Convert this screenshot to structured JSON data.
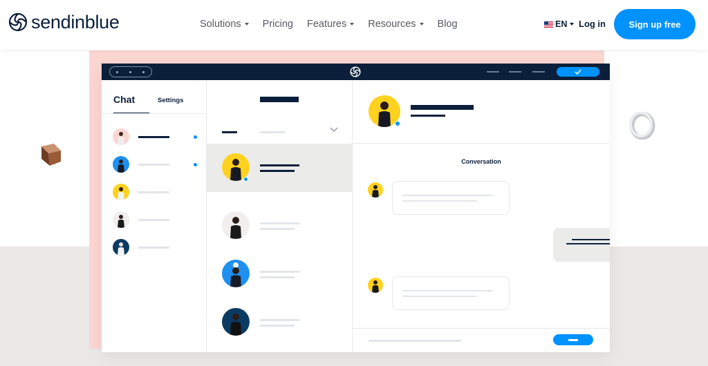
{
  "brand": {
    "name": "sendinblue",
    "color": "#0b1f3a",
    "accent": "#0092ff"
  },
  "nav": {
    "menu": [
      {
        "label": "Solutions",
        "has_dropdown": true
      },
      {
        "label": "Pricing",
        "has_dropdown": false
      },
      {
        "label": "Features",
        "has_dropdown": true
      },
      {
        "label": "Resources",
        "has_dropdown": true
      },
      {
        "label": "Blog",
        "has_dropdown": false
      }
    ],
    "language": "EN",
    "login": "Log in",
    "signup": "Sign up free"
  },
  "chat_app": {
    "tabs": [
      {
        "label": "Chat",
        "active": true
      },
      {
        "label": "Settings",
        "active": false
      }
    ],
    "contact_avatar_colors": [
      "#fbd6d1",
      "#1e90f0",
      "#ffd21f",
      "#f1efee",
      "#0b3a63"
    ],
    "conversation_avatar_colors": [
      "#ffd21f",
      "#f1efee",
      "#1e90f0",
      "#0b3a63"
    ],
    "conversation_label": "Conversation",
    "icons": [
      "sendinblue-logo-icon",
      "checkmark-icon",
      "chevron-down-icon",
      "minus-icon"
    ]
  },
  "colors": {
    "pink_panel": "#fbd6d1",
    "lower_background": "#e9e8e6"
  }
}
